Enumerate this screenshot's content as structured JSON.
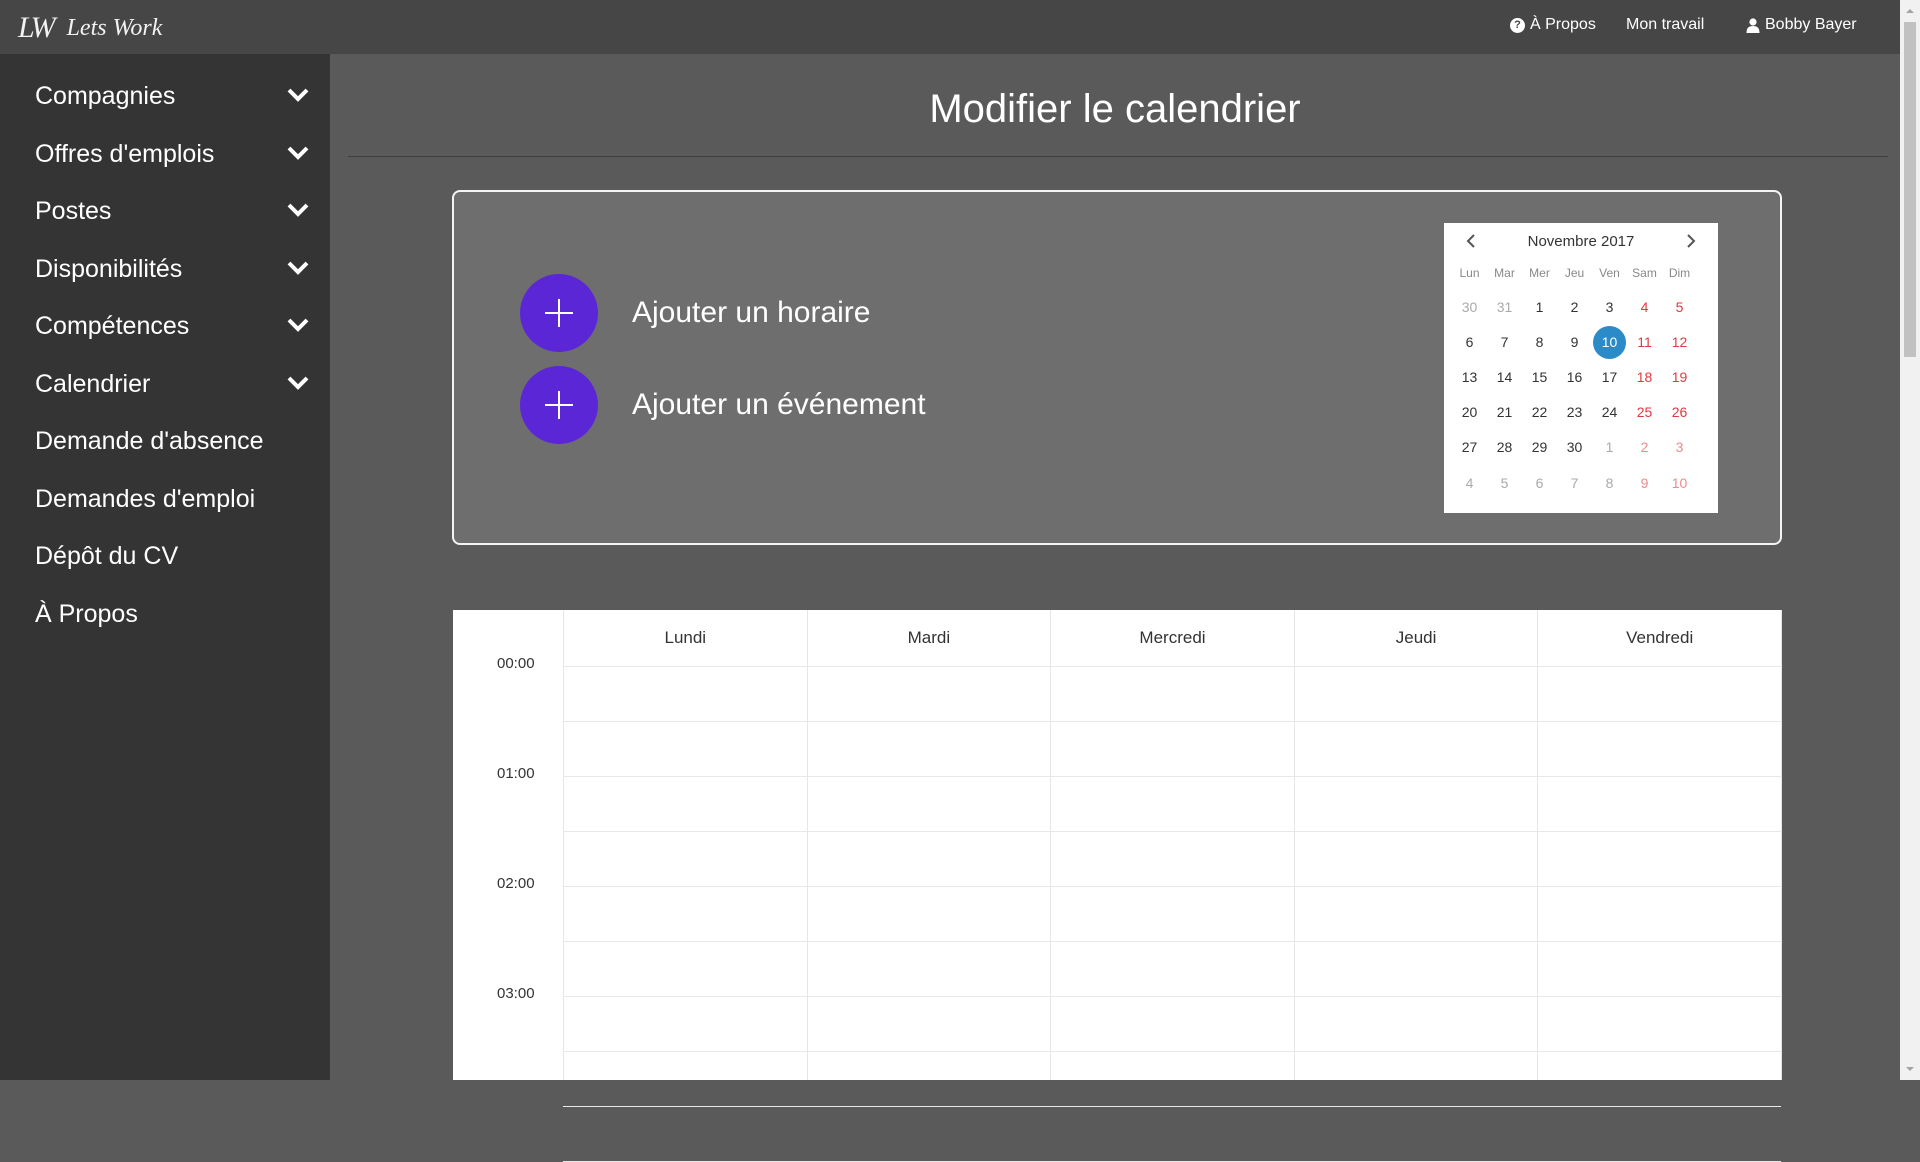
{
  "brand": {
    "mark": "LW",
    "name": "Lets Work"
  },
  "topnav": {
    "about": "À Propos",
    "work": "Mon travail",
    "user": "Bobby Bayer"
  },
  "sidebar": {
    "items": [
      {
        "label": "Compagnies",
        "icon": "chevron-down-icon"
      },
      {
        "label": "Offres d'emplois",
        "icon": "chevron-down-icon"
      },
      {
        "label": "Postes",
        "icon": "chevron-down-icon"
      },
      {
        "label": "Disponibilités",
        "icon": "chevron-down-icon"
      },
      {
        "label": "Compétences",
        "icon": "chevron-down-icon"
      },
      {
        "label": "Calendrier",
        "icon": "chevron-down-icon"
      },
      {
        "label": "Demande d'absence"
      },
      {
        "label": "Demandes d'emploi"
      },
      {
        "label": "Dépôt du CV"
      },
      {
        "label": "À Propos"
      }
    ]
  },
  "page": {
    "title": "Modifier le calendrier"
  },
  "actions": {
    "add_schedule": "Ajouter un horaire",
    "add_event": "Ajouter un événement"
  },
  "minical": {
    "month": "Novembre 2017",
    "days_of_week": [
      "Lun",
      "Mar",
      "Mer",
      "Jeu",
      "Ven",
      "Sam",
      "Dim"
    ],
    "weeks": [
      [
        "30",
        "31",
        "1",
        "2",
        "3",
        "4",
        "5"
      ],
      [
        "6",
        "7",
        "8",
        "9",
        "10",
        "11",
        "12"
      ],
      [
        "13",
        "14",
        "15",
        "16",
        "17",
        "18",
        "19"
      ],
      [
        "20",
        "21",
        "22",
        "23",
        "24",
        "25",
        "26"
      ],
      [
        "27",
        "28",
        "29",
        "30",
        "1",
        "2",
        "3"
      ],
      [
        "4",
        "5",
        "6",
        "7",
        "8",
        "9",
        "10"
      ]
    ],
    "selected": "10"
  },
  "week_view": {
    "days": [
      "Lundi",
      "Mardi",
      "Mercredi",
      "Jeudi",
      "Vendredi"
    ],
    "times": [
      "00:00",
      "01:00",
      "02:00",
      "03:00"
    ]
  },
  "colors": {
    "accent": "#5b27d6",
    "selected_day": "#2a8bc8",
    "weekend": "#e0393e",
    "sidebar_bg": "#343434",
    "topbar_bg": "#464646"
  }
}
